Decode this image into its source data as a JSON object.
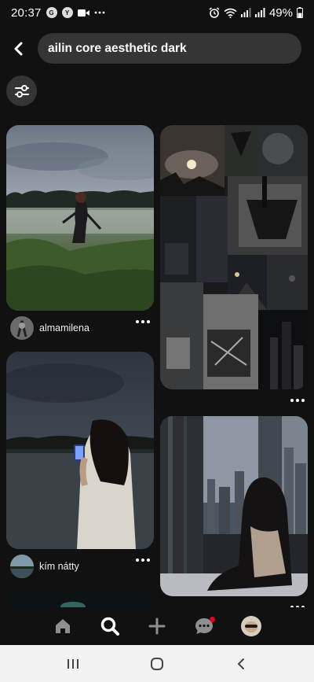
{
  "status_bar": {
    "time": "20:37",
    "battery": "49%",
    "icons": [
      "g-icon",
      "yt-icon",
      "video-icon",
      "more-dots-icon",
      "alarm-icon",
      "wifi-icon",
      "signal-icon",
      "signal-icon",
      "battery-icon"
    ]
  },
  "search": {
    "query": "ailin core aesthetic dark"
  },
  "pins": [
    {
      "username": "almamilena"
    },
    {
      "username": "kím nátty"
    }
  ],
  "bottom_nav": {
    "items": [
      "home-icon",
      "search-icon",
      "add-icon",
      "messages-icon",
      "profile-avatar"
    ]
  },
  "colors": {
    "background": "#111111",
    "surface": "#353535",
    "notification": "#e60023"
  }
}
